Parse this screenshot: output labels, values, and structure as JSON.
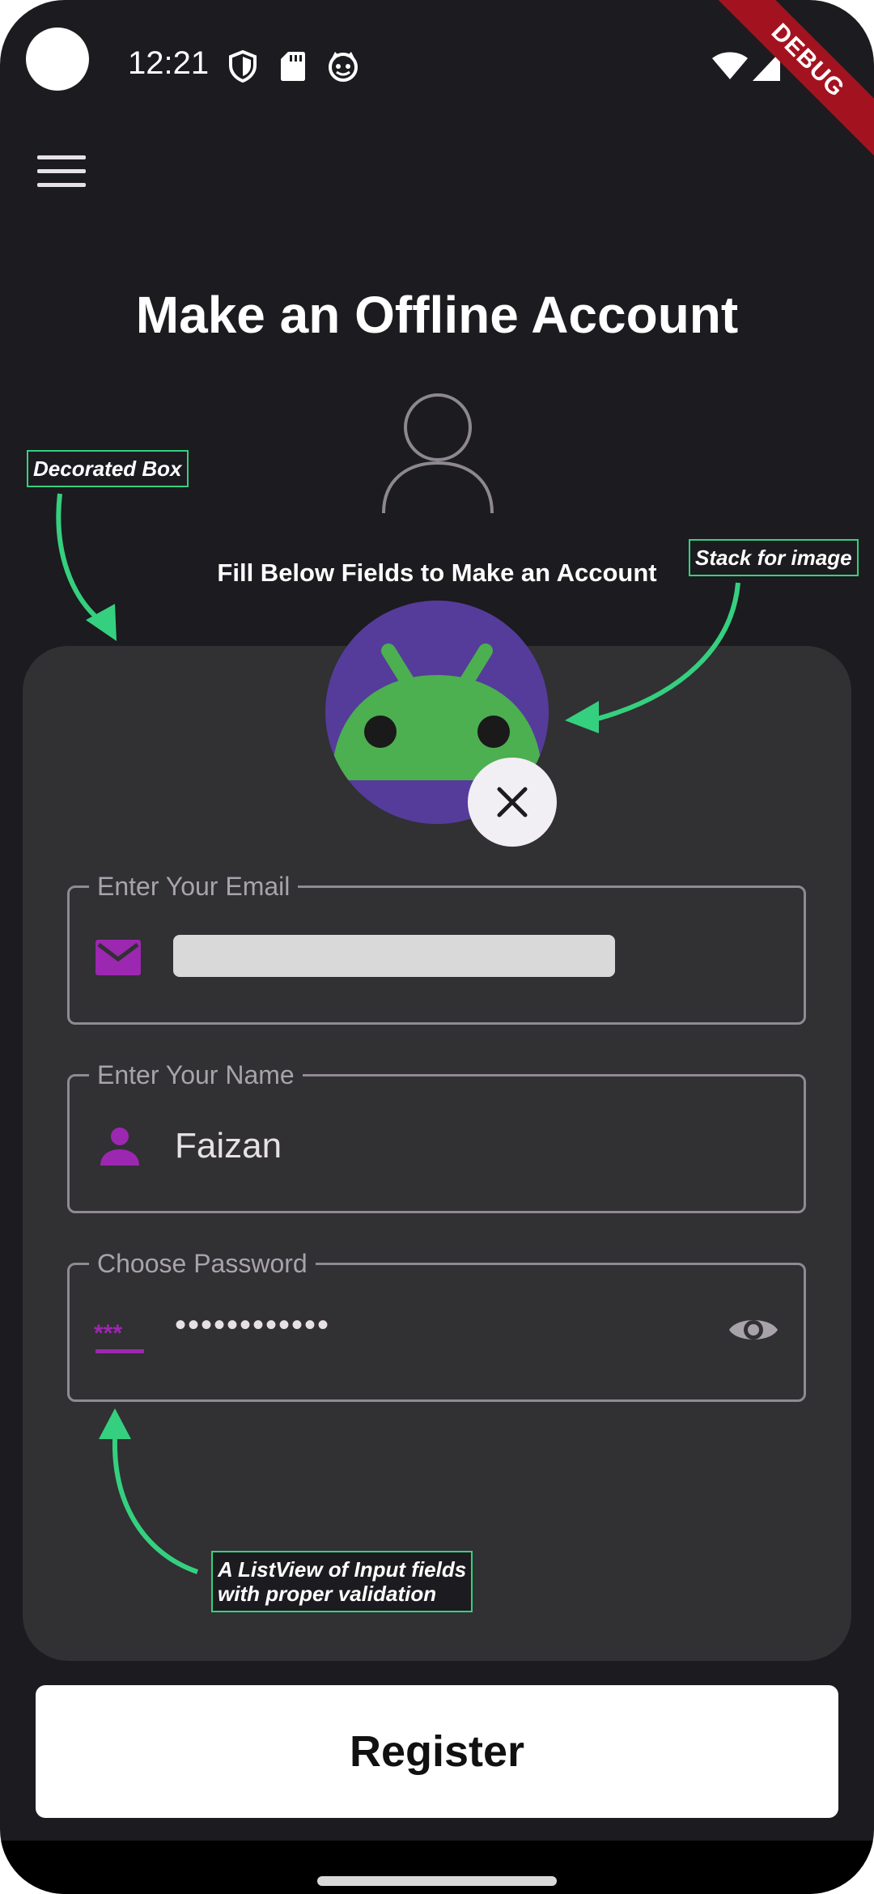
{
  "status_bar": {
    "time": "12:21",
    "debug_label": "DEBUG"
  },
  "header": {
    "title": "Make an Offline Account",
    "subtitle": "Fill Below Fields to Make an Account"
  },
  "annotations": {
    "decorated_box": "Decorated Box",
    "stack_for_image": "Stack for image",
    "listview_line1": "A ListView of Input fields",
    "listview_line2": "with proper validation"
  },
  "form": {
    "email": {
      "label": "Enter Your Email",
      "value": ""
    },
    "name": {
      "label": "Enter Your Name",
      "value": "Faizan"
    },
    "password": {
      "label": "Choose Password",
      "value": "••••••••••••"
    }
  },
  "register_button": {
    "label": "Register"
  },
  "colors": {
    "background": "#1c1b1f",
    "card": "#313033",
    "accent": "#9c27b0",
    "annotation": "#35d07f"
  }
}
